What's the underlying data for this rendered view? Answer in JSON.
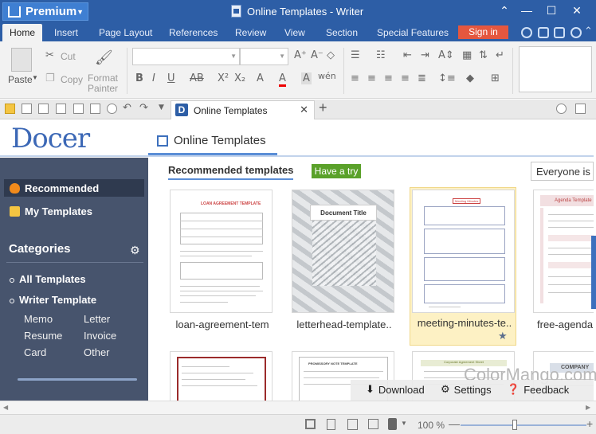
{
  "titlebar": {
    "premium_label": "Premium",
    "window_title": "Online Templates - Writer"
  },
  "menu": {
    "tabs": [
      "Home",
      "Insert",
      "Page Layout",
      "References",
      "Review",
      "View",
      "Section",
      "Special Features"
    ],
    "signin": "Sign in"
  },
  "ribbon": {
    "paste": "Paste",
    "cut": "Cut",
    "copy": "Copy",
    "format_painter_1": "Format",
    "format_painter_2": "Painter"
  },
  "doc_tab": {
    "name": "Online Templates"
  },
  "docer": {
    "logo": "Docer",
    "tab": "Online Templates",
    "sidebar": {
      "recommended": "Recommended",
      "my_templates": "My Templates",
      "categories": "Categories",
      "all_templates": "All Templates",
      "writer_template": "Writer Template",
      "subs": [
        "Memo",
        "Letter",
        "Resume",
        "Invoice",
        "Card",
        "Other"
      ]
    },
    "main": {
      "recommended_title": "Recommended templates",
      "try_button": "Have a try",
      "filter": "Everyone is",
      "templates": [
        {
          "name": "loan-agreement-tem",
          "title": "LOAN AGREEMENT TEMPLATE"
        },
        {
          "name": "letterhead-template..",
          "title": "Document Title"
        },
        {
          "name": "meeting-minutes-te..",
          "title": "Meeting Minutes"
        },
        {
          "name": "free-agenda",
          "title": "Agenda Template"
        }
      ],
      "row2_titles": [
        "",
        "PROMISSORY NOTE TEMPLATE",
        "Corporate Agreement Sheet",
        "COMPANY"
      ]
    }
  },
  "actions": {
    "download": "Download",
    "settings": "Settings",
    "feedback": "Feedback"
  },
  "watermark": "ColorMango.com",
  "status": {
    "zoom": "100 %"
  },
  "colors": {
    "titlebar": "#2d5ea6",
    "signin": "#e4573f",
    "sidebar": "#47546d",
    "try": "#5aa12a",
    "selected_card": "#fdf1c4"
  }
}
